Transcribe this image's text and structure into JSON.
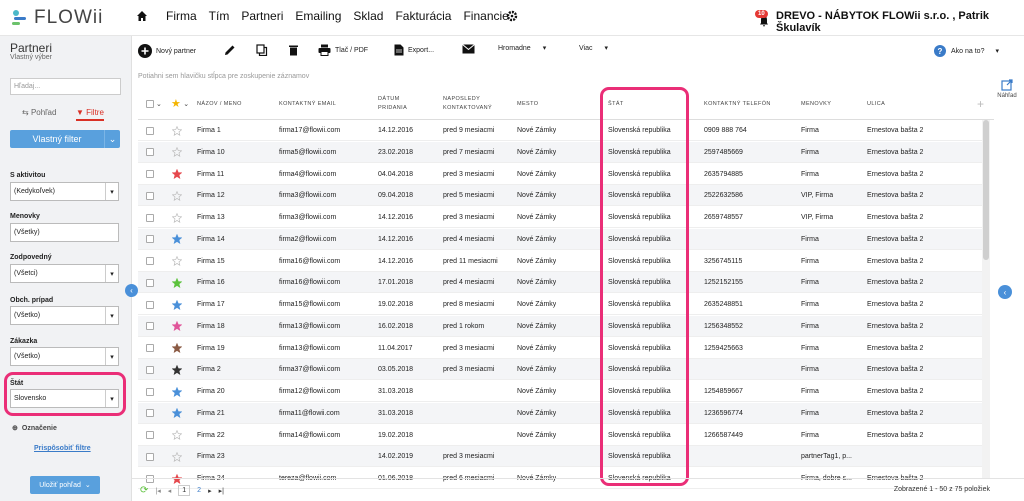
{
  "app": {
    "logo": "FLOWii",
    "company": "DREVO - NÁBYTOK FLOWii s.r.o. , Patrik Škulavík",
    "notif_count": "10"
  },
  "nav": [
    "Firma",
    "Tím",
    "Partneri",
    "Emailing",
    "Sklad",
    "Fakturácia",
    "Financie"
  ],
  "sidebar": {
    "title": "Partneri",
    "subtitle": "Vlastný výber",
    "search_placeholder": "Hľadaj...",
    "tab_view": "Pohľad",
    "tab_filters": "Filtre",
    "custom_filter": "Vlastný filter",
    "filters": [
      {
        "label": "S aktivitou",
        "value": "(Kedykoľvek)"
      },
      {
        "label": "Menovky",
        "value": "(Všetky)"
      },
      {
        "label": "Zodpovedný",
        "value": "(Všetci)"
      },
      {
        "label": "Obch. prípad",
        "value": "(Všetko)"
      },
      {
        "label": "Zákazka",
        "value": "(Všetko)"
      },
      {
        "label": "Štát",
        "value": "Slovensko"
      }
    ],
    "oznacenie": "Označenie",
    "customize": "Prispôsobiť filtre",
    "save_view": "Uložiť pohľad"
  },
  "toolbar": {
    "new_partner": "Nový partner",
    "print": "Tlač / PDF",
    "export": "Export...",
    "bulk": "Hromadne",
    "more": "Viac",
    "help": "Ako na to?"
  },
  "grid": {
    "group_hint": "Potiahni sem hlavičku stĺpca pre zoskupenie záznamov",
    "preview": "Náhľad",
    "headers": {
      "name": "NÁZOV / MENO",
      "email": "KONTAKTNÝ EMAIL",
      "date1": "DÁTUM",
      "date2": "PRIDANIA",
      "contact1": "NAPOSLEDY",
      "contact2": "KONTAKTOVANÝ",
      "city": "MESTO",
      "state": "ŠTÁT",
      "phone": "KONTAKTNÝ TELEFÓN",
      "tags": "MENOVKY",
      "street": "ULICA"
    },
    "rows": [
      {
        "star": "",
        "name": "Firma 1",
        "email": "firma17@flowii.com",
        "date": "14.12.2016",
        "last": "pred 9 mesiacmi",
        "city": "Nové Zámky",
        "state": "Slovenská republika",
        "phone": "0909 888 764",
        "tags": "Firma",
        "street": "Ernestova bašta 2"
      },
      {
        "star": "",
        "name": "Firma 10",
        "email": "firma5@flowii.com",
        "date": "23.02.2018",
        "last": "pred 7 mesiacmi",
        "city": "Nové Zámky",
        "state": "Slovenská republika",
        "phone": "2597485669",
        "tags": "Firma",
        "street": "Ernestova bašta 2"
      },
      {
        "star": "#e5484d",
        "name": "Firma 11",
        "email": "firma4@flowii.com",
        "date": "04.04.2018",
        "last": "pred 3 mesiacmi",
        "city": "Nové Zámky",
        "state": "Slovenská republika",
        "phone": "2635794885",
        "tags": "Firma",
        "street": "Ernestova bašta 2"
      },
      {
        "star": "",
        "name": "Firma 12",
        "email": "firma3@flowii.com",
        "date": "09.04.2018",
        "last": "pred 5 mesiacmi",
        "city": "Nové Zámky",
        "state": "Slovenská republika",
        "phone": "2522632586",
        "tags": "VIP, Firma",
        "street": "Ernestova bašta 2"
      },
      {
        "star": "",
        "name": "Firma 13",
        "email": "firma3@flowii.com",
        "date": "14.12.2016",
        "last": "pred 3 mesiacmi",
        "city": "Nové Zámky",
        "state": "Slovenská republika",
        "phone": "2659748557",
        "tags": "VIP, Firma",
        "street": "Ernestova bašta 2"
      },
      {
        "star": "#4a90d9",
        "name": "Firma 14",
        "email": "firma2@flowii.com",
        "date": "14.12.2016",
        "last": "pred 4 mesiacmi",
        "city": "Nové Zámky",
        "state": "Slovenská republika",
        "phone": "",
        "tags": "Firma",
        "street": "Ernestova bašta 2"
      },
      {
        "star": "",
        "name": "Firma 15",
        "email": "firma16@flowii.com",
        "date": "14.12.2016",
        "last": "pred 11 mesiacmi",
        "city": "Nové Zámky",
        "state": "Slovenská republika",
        "phone": "3256745115",
        "tags": "Firma",
        "street": "Ernestova bašta 2"
      },
      {
        "star": "#5cc23c",
        "name": "Firma 16",
        "email": "firma16@flowii.com",
        "date": "17.01.2018",
        "last": "pred 4 mesiacmi",
        "city": "Nové Zámky",
        "state": "Slovenská republika",
        "phone": "1252152155",
        "tags": "Firma",
        "street": "Ernestova bašta 2"
      },
      {
        "star": "#4a90d9",
        "name": "Firma 17",
        "email": "firma15@flowii.com",
        "date": "19.02.2018",
        "last": "pred 8 mesiacmi",
        "city": "Nové Zámky",
        "state": "Slovenská republika",
        "phone": "2635248851",
        "tags": "Firma",
        "street": "Ernestova bašta 2"
      },
      {
        "star": "#e0559a",
        "name": "Firma 18",
        "email": "firma13@flowii.com",
        "date": "16.02.2018",
        "last": "pred 1 rokom",
        "city": "Nové Zámky",
        "state": "Slovenská republika",
        "phone": "1256348552",
        "tags": "Firma",
        "street": "Ernestova bašta 2"
      },
      {
        "star": "#8a5a44",
        "name": "Firma 19",
        "email": "firma13@flowii.com",
        "date": "11.04.2017",
        "last": "pred 3 mesiacmi",
        "city": "Nové Zámky",
        "state": "Slovenská republika",
        "phone": "1259425663",
        "tags": "Firma",
        "street": "Ernestova bašta 2"
      },
      {
        "star": "#333333",
        "name": "Firma 2",
        "email": "firma37@flowii.com",
        "date": "03.05.2018",
        "last": "pred 3 mesiacmi",
        "city": "Nové Zámky",
        "state": "Slovenská republika",
        "phone": "",
        "tags": "Firma",
        "street": "Ernestova bašta 2"
      },
      {
        "star": "#4a90d9",
        "name": "Firma 20",
        "email": "firma12@flowii.com",
        "date": "31.03.2018",
        "last": "",
        "city": "Nové Zámky",
        "state": "Slovenská republika",
        "phone": "1254859667",
        "tags": "Firma",
        "street": "Ernestova bašta 2"
      },
      {
        "star": "#4a90d9",
        "name": "Firma 21",
        "email": "firma11@flowii.com",
        "date": "31.03.2018",
        "last": "",
        "city": "Nové Zámky",
        "state": "Slovenská republika",
        "phone": "1236596774",
        "tags": "Firma",
        "street": "Ernestova bašta 2"
      },
      {
        "star": "",
        "name": "Firma 22",
        "email": "firma14@flowii.com",
        "date": "19.02.2018",
        "last": "",
        "city": "Nové Zámky",
        "state": "Slovenská republika",
        "phone": "1266587449",
        "tags": "Firma",
        "street": "Ernestova bašta 2"
      },
      {
        "star": "",
        "name": "Firma 23",
        "email": "",
        "date": "14.02.2019",
        "last": "pred 3 mesiacmi",
        "city": "",
        "state": "Slovenská republika",
        "phone": "",
        "tags": "partnerTag1, p...",
        "street": ""
      },
      {
        "star": "#e5484d",
        "name": "Firma 24",
        "email": "tereza@flowii.com",
        "date": "01.06.2018",
        "last": "pred 6 mesiacmi",
        "city": "Nové Zámky",
        "state": "Slovenská republika",
        "phone": "",
        "tags": "Firma, dobre s...",
        "street": "Ernestova bašta 2"
      }
    ]
  },
  "footer": {
    "page1": "1",
    "page2": "2",
    "summary": "Zobrazené 1 - 50 z 75 položiek"
  }
}
